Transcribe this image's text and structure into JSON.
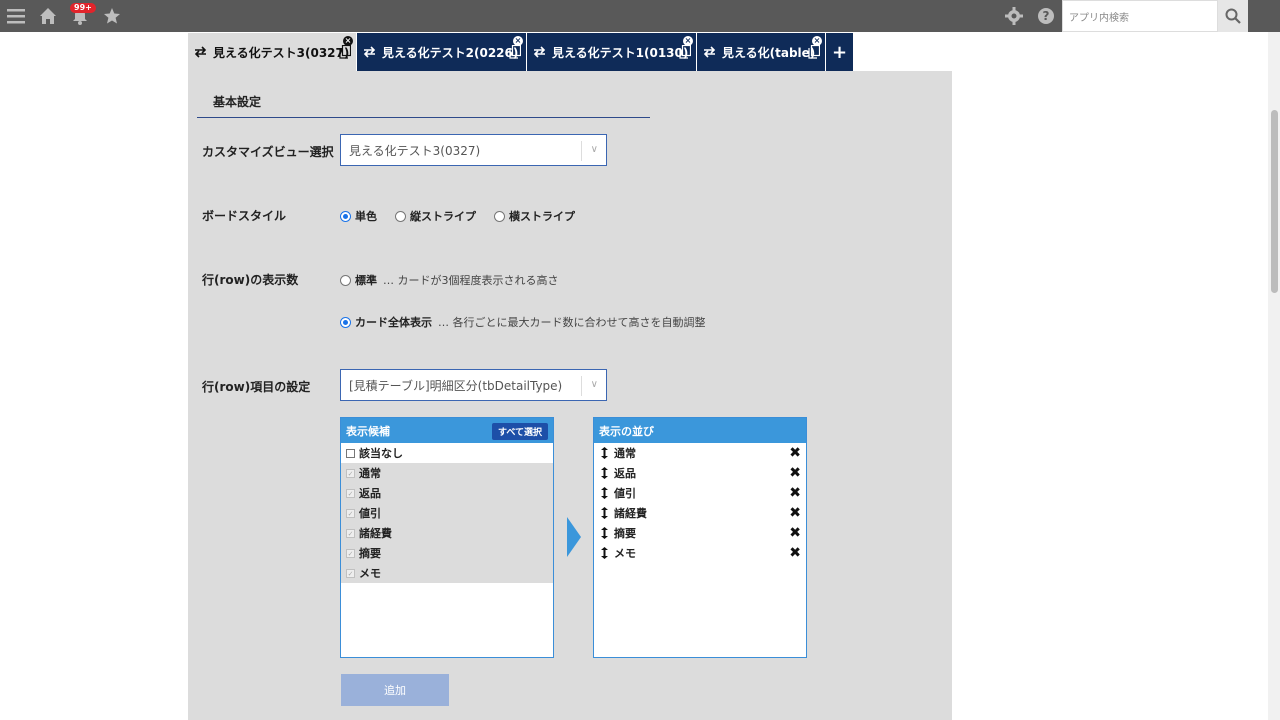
{
  "topbar": {
    "notification_badge": "99+",
    "search_placeholder": "アプリ内検索",
    "icons": [
      "menu-icon",
      "home-icon",
      "bell-icon",
      "star-icon",
      "gear-icon",
      "help-icon",
      "search-icon"
    ]
  },
  "tabs": [
    {
      "label": "見える化テスト3(0327)",
      "active": true
    },
    {
      "label": "見える化テスト2(0226)",
      "active": false
    },
    {
      "label": "見える化テスト1(0130)",
      "active": false
    },
    {
      "label": "見える化(table)",
      "active": false
    }
  ],
  "tab_add_label": "+",
  "panel": {
    "section_title": "基本設定",
    "customize_view": {
      "label": "カスタマイズビュー選択",
      "value": "見える化テスト3(0327)"
    },
    "board_style": {
      "label": "ボードスタイル",
      "options": [
        {
          "label": "単色",
          "checked": true
        },
        {
          "label": "縦ストライプ",
          "checked": false
        },
        {
          "label": "横ストライプ",
          "checked": false
        }
      ]
    },
    "row_count": {
      "label": "行(row)の表示数",
      "options": [
        {
          "label": "標準",
          "desc": "… カードが3個程度表示される高さ",
          "checked": false
        },
        {
          "label": "カード全体表示",
          "desc": "… 各行ごとに最大カード数に合わせて高さを自動調整",
          "checked": true
        }
      ]
    },
    "row_item": {
      "label": "行(row)項目の設定",
      "value": "[見積テーブル]明細区分(tbDetailType)"
    },
    "candidates": {
      "header": "表示候補",
      "select_all": "すべて選択",
      "items": [
        {
          "label": "該当なし",
          "disabled": false
        },
        {
          "label": "通常",
          "disabled": true
        },
        {
          "label": "返品",
          "disabled": true
        },
        {
          "label": "値引",
          "disabled": true
        },
        {
          "label": "諸経費",
          "disabled": true
        },
        {
          "label": "摘要",
          "disabled": true
        },
        {
          "label": "メモ",
          "disabled": true
        }
      ]
    },
    "order": {
      "header": "表示の並び",
      "items": [
        "通常",
        "返品",
        "値引",
        "諸経費",
        "摘要",
        "メモ"
      ]
    },
    "add_button": "追加"
  },
  "colors": {
    "topbar": "#595959",
    "tab_dark": "#0f2b58",
    "panel": "#dcdcdc",
    "list_header": "#3b97db",
    "add_button": "#9ab1da"
  }
}
